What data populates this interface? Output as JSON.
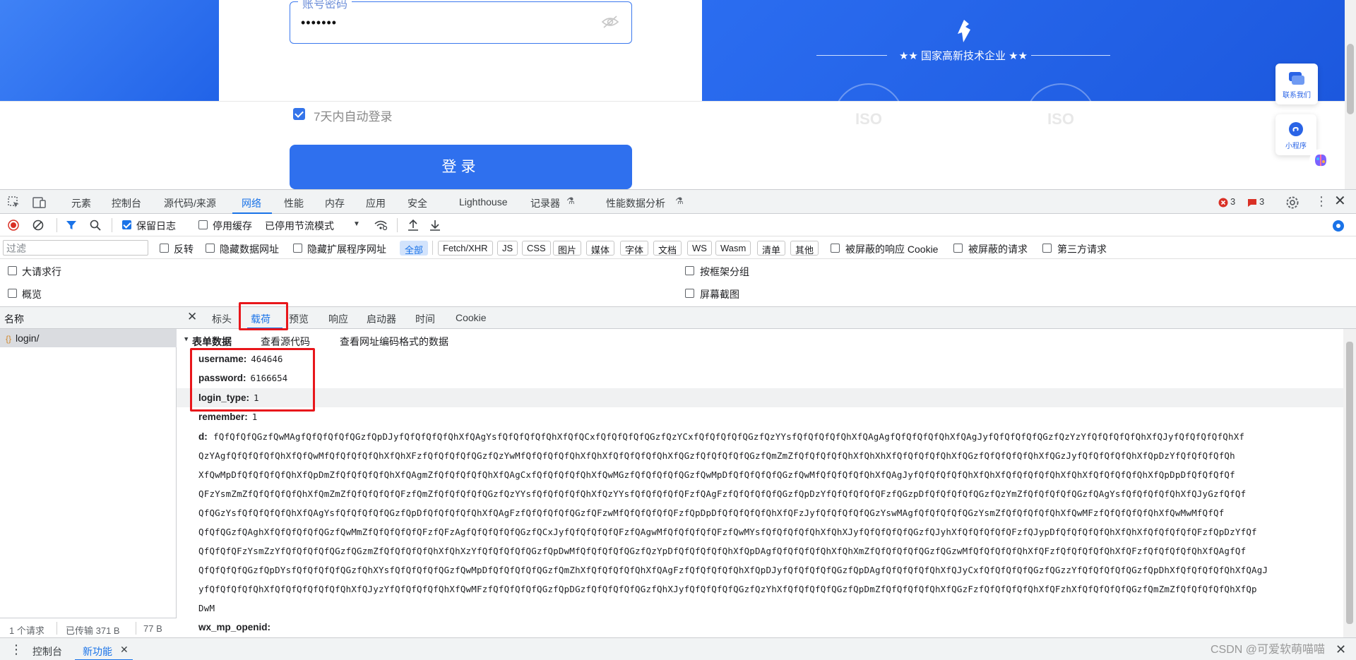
{
  "site": {
    "password_legend": "账号密码",
    "password_value": "•••••••",
    "auto_login_label": "7天内自动登录",
    "login_button": "登录",
    "hightech_label": "★★  国家高新技术企业  ★★",
    "iso_label": "ISO",
    "contact_label": "联系我们",
    "miniapp_label": "小程序",
    "brand_color": "#2f70ee"
  },
  "devtools": {
    "tabs": [
      "元素",
      "控制台",
      "源代码/来源",
      "网络",
      "性能",
      "内存",
      "应用",
      "安全",
      "Lighthouse",
      "记录器",
      "性能数据分析"
    ],
    "active_tab": "网络",
    "error_count": "3",
    "issue_count": "3",
    "toolbar": {
      "preserve_log": "保留日志",
      "disable_cache": "停用缓存",
      "throttling": "已停用节流模式"
    },
    "filter": {
      "placeholder": "过滤",
      "invert": "反转",
      "hide_data_urls": "隐藏数据网址",
      "hide_ext_urls": "隐藏扩展程序网址",
      "types": [
        "全部",
        "Fetch/XHR",
        "JS",
        "CSS",
        "图片",
        "媒体",
        "字体",
        "文档",
        "WS",
        "Wasm",
        "清单",
        "其他"
      ],
      "blocked_cookies": "被屏蔽的响应 Cookie",
      "blocked_requests": "被屏蔽的请求",
      "third_party": "第三方请求"
    },
    "options": {
      "big_rows": "大请求行",
      "overview": "概览",
      "group_by_frame": "按框架分组",
      "screenshots": "屏幕截图"
    },
    "requests": {
      "name_header": "名称",
      "items": [
        {
          "name": "login/"
        }
      ],
      "status": {
        "count": "1 个请求",
        "transferred": "已传输 371 B",
        "size": "77 B"
      }
    },
    "detail": {
      "tabs": [
        "标头",
        "载荷",
        "预览",
        "响应",
        "启动器",
        "时间",
        "Cookie"
      ],
      "active_tab": "载荷",
      "section_title": "表单数据",
      "view_source": "查看源代码",
      "view_url_encoded": "查看网址编码格式的数据",
      "fields": [
        {
          "key": "username:",
          "value": "464646"
        },
        {
          "key": "password:",
          "value": "6166654"
        },
        {
          "key": "login_type:",
          "value": "1"
        },
        {
          "key": "remember:",
          "value": "1"
        },
        {
          "key": "d:",
          "value": ""
        },
        {
          "key": "wx_mp_openid:",
          "value": ""
        }
      ],
      "d_lines": [
        "fQfQfQfQGzfQwMAgfQfQfQfQfQGzfQpDJyfQfQfQfQfQhXfQAgYsfQfQfQfQfQhXfQfQCxfQfQfQfQfQGzfQzYCxfQfQfQfQfQGzfQzYYsfQfQfQfQfQhXfQAgAgfQfQfQfQfQhXfQAgJyfQfQfQfQfQGzfQzYzYfQfQfQfQfQhXfQJyfQfQfQfQfQhXf",
        "QzYAgfQfQfQfQfQhXfQfQwMfQfQfQfQfQhXfQhXFzfQfQfQfQfQGzfQzYwMfQfQfQfQfQhXfQhXfQfQfQfQfQhXfQGzfQfQfQfQfQGzfQmZmZfQfQfQfQfQhXfQhXhXfQfQfQfQfQhXfQGzfQfQfQfQfQhXfQGzJyfQfQfQfQfQhXfQpDzYfQfQfQfQfQh",
        "XfQwMpDfQfQfQfQfQhXfQpDmZfQfQfQfQfQhXfQAgmZfQfQfQfQfQhXfQAgCxfQfQfQfQfQhXfQwMGzfQfQfQfQfQGzfQwMpDfQfQfQfQfQGzfQwMfQfQfQfQfQhXfQAgJyfQfQfQfQfQhXfQhXfQfQfQfQfQhXfQhXfQfQfQfQfQhXfQpDpDfQfQfQfQf",
        "QFzYsmZmZfQfQfQfQfQhXfQmZmZfQfQfQfQfQFzfQmZfQfQfQfQfQGzfQzYYsfQfQfQfQfQhXfQzYYsfQfQfQfQfQFzfQAgFzfQfQfQfQfQGzfQpDzYfQfQfQfQfQFzfQGzpDfQfQfQfQfQGzfQzYmZfQfQfQfQfQGzfQAgYsfQfQfQfQfQhXfQJyGzfQfQf",
        "QfQGzYsfQfQfQfQfQhXfQAgYsfQfQfQfQfQGzfQpDfQfQfQfQfQhXfQAgFzfQfQfQfQfQGzfQFzwMfQfQfQfQfQFzfQpDpDfQfQfQfQfQhXfQFzJyfQfQfQfQfQGzYswMAgfQfQfQfQfQGzYsmZfQfQfQfQfQhXfQwMFzfQfQfQfQfQhXfQwMwMfQfQf",
        "QfQfQGzfQAghXfQfQfQfQfQGzfQwMmZfQfQfQfQfQFzfQFzAgfQfQfQfQfQGzfQCxJyfQfQfQfQfQFzfQAgwMfQfQfQfQfQFzfQwMYsfQfQfQfQfQhXfQhXJyfQfQfQfQfQGzfQJyhXfQfQfQfQfQFzfQJypDfQfQfQfQfQhXfQhXfQfQfQfQfQFzfQpDzYfQf",
        "QfQfQfQFzYsmZzYfQfQfQfQfQGzfQGzmZfQfQfQfQfQhXfQhXzYfQfQfQfQfQGzfQpDwMfQfQfQfQfQGzfQzYpDfQfQfQfQfQhXfQpDAgfQfQfQfQfQhXfQhXmZfQfQfQfQfQGzfQGzwMfQfQfQfQfQhXfQFzfQfQfQfQfQhXfQFzfQfQfQfQfQhXfQAgfQf",
        "QfQfQfQfQGzfQpDYsfQfQfQfQfQGzfQhXYsfQfQfQfQfQGzfQwMpDfQfQfQfQfQGzfQmZhXfQfQfQfQfQhXfQAgFzfQfQfQfQfQhXfQpDJyfQfQfQfQfQGzfQpDAgfQfQfQfQfQhXfQJyCxfQfQfQfQfQGzfQGzzYfQfQfQfQfQGzfQpDhXfQfQfQfQfQhXfQAgJ",
        "yfQfQfQfQfQhXfQfQfQfQfQfQfQhXfQJyzYfQfQfQfQfQhXfQwMFzfQfQfQfQfQGzfQpDGzfQfQfQfQfQGzfQhXJyfQfQfQfQfQGzfQzYhXfQfQfQfQfQGzfQpDmZfQfQfQfQfQhXfQGzFzfQfQfQfQfQhXfQFzhXfQfQfQfQfQGzfQmZmZfQfQfQfQfQhXfQp",
        "DwM"
      ]
    },
    "drawer": {
      "tabs": [
        "控制台",
        "新功能"
      ],
      "active_tab": "新功能"
    },
    "accent_color": "#1a73e8",
    "highlight_color": "#e8161b"
  },
  "watermark": "CSDN @可爱软萌喵喵"
}
